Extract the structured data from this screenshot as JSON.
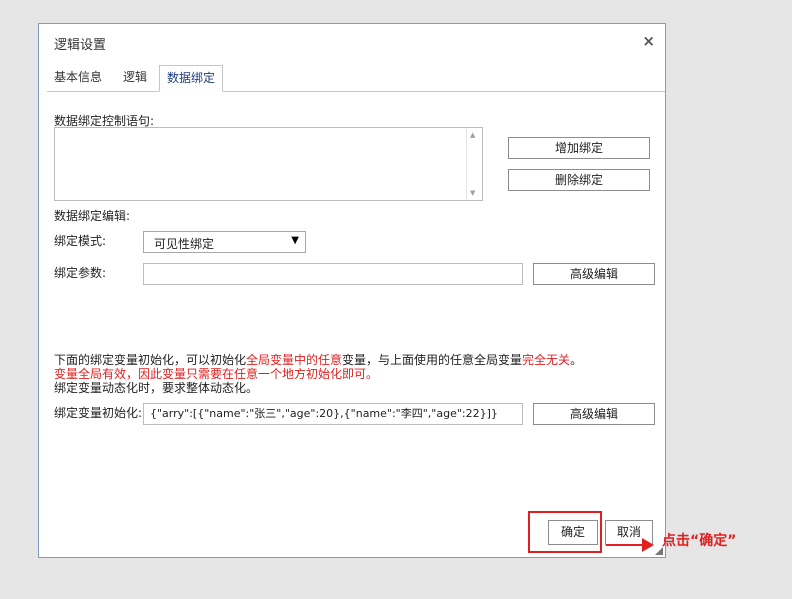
{
  "dialog": {
    "title": "逻辑设置",
    "close_icon": "×"
  },
  "tabs": [
    {
      "label": "基本信息",
      "active": false
    },
    {
      "label": "逻辑",
      "active": false
    },
    {
      "label": "数据绑定",
      "active": true
    }
  ],
  "binding": {
    "control_label": "数据绑定控制语句:",
    "control_value": "",
    "add_button": "增加绑定",
    "delete_button": "删除绑定",
    "edit_label": "数据绑定编辑:",
    "mode_label": "绑定模式:",
    "mode_value": "可见性绑定",
    "mode_arrow": "▼",
    "param_label": "绑定参数:",
    "param_value": "",
    "param_advanced_button": "高级编辑"
  },
  "notes": {
    "line1_a": "下面的绑定变量初始化，可以初始化",
    "line1_b": "全局变量中的任意",
    "line1_c": "变量，与上面使用的任意全局变量",
    "line1_d": "完全无关",
    "line1_e": "。",
    "line2": "变量全局有效，因此变量只需要在任意一个地方初始化即可。",
    "line3": "绑定变量动态化时，要求整体动态化。"
  },
  "init": {
    "label": "绑定变量初始化:",
    "value": "{\"arry\":[{\"name\":\"张三\",\"age\":20},{\"name\":\"李四\",\"age\":22}]}",
    "advanced_button": "高级编辑"
  },
  "footer": {
    "ok_button": "确定",
    "cancel_button": "取消"
  },
  "annotation": {
    "text": "点击“确定”"
  },
  "colors": {
    "highlight": "#e02020",
    "dialog_border": "#7a9cc6"
  }
}
